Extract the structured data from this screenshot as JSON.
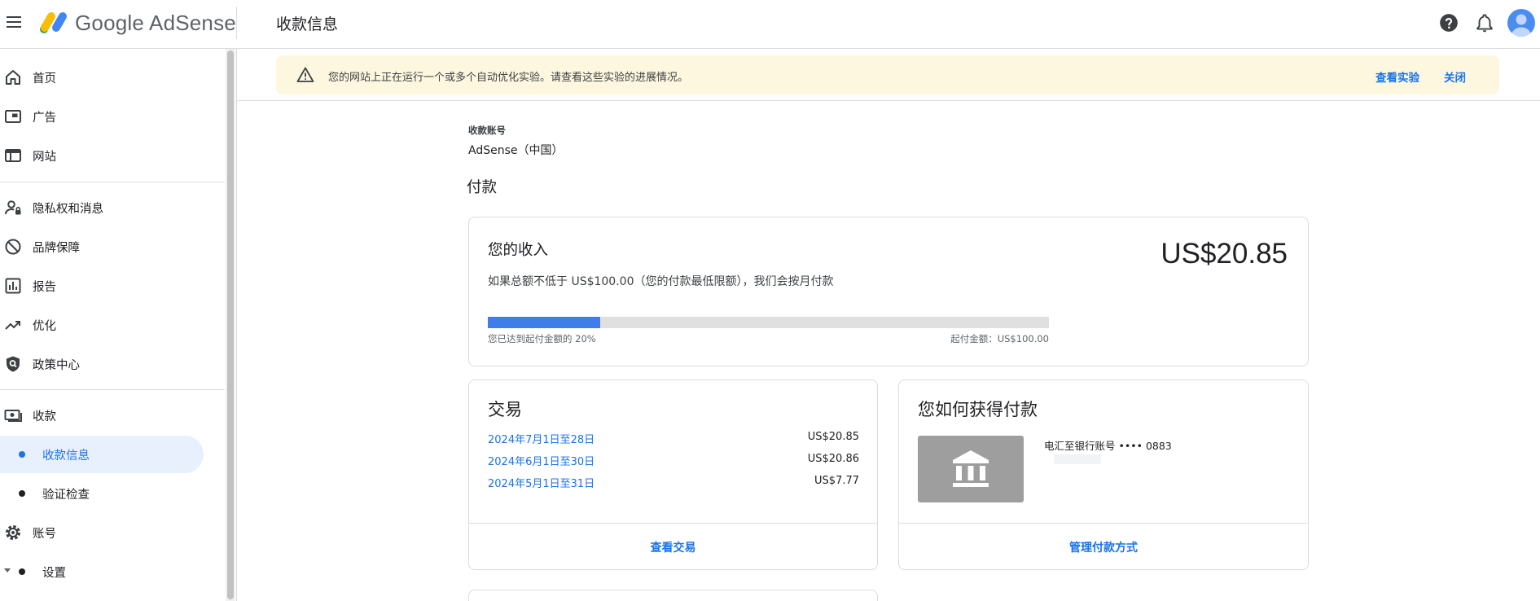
{
  "header": {
    "brand": "Google AdSense",
    "page_title": "收款信息"
  },
  "sidebar": {
    "items": [
      {
        "label": "首页",
        "icon": "home-icon"
      },
      {
        "label": "广告",
        "icon": "ads-icon"
      },
      {
        "label": "网站",
        "icon": "sites-icon"
      },
      {
        "label": "隐私权和消息",
        "icon": "privacy-icon"
      },
      {
        "label": "品牌保障",
        "icon": "block-icon"
      },
      {
        "label": "报告",
        "icon": "reports-icon"
      },
      {
        "label": "优化",
        "icon": "trending-icon"
      },
      {
        "label": "政策中心",
        "icon": "policy-shield-icon"
      },
      {
        "label": "收款",
        "icon": "payments-icon"
      },
      {
        "label": "收款信息",
        "active": true
      },
      {
        "label": "验证检查"
      },
      {
        "label": "账号",
        "icon": "gear-icon"
      },
      {
        "label": "设置"
      }
    ]
  },
  "banner": {
    "text": "您的网站上正在运行一个或多个自动优化实验。请查看这些实验的进展情况。",
    "view_label": "查看实验",
    "close_label": "关闭"
  },
  "account": {
    "label": "收款账号",
    "value": "AdSense（中国）"
  },
  "section_title": "付款",
  "earnings": {
    "title": "您的收入",
    "amount": "US$20.85",
    "description": "如果总额不低于 US$100.00（您的付款最低限额），我们会按月付款",
    "progress_percent": 20,
    "progress_left": "您已达到起付金额的 20%",
    "progress_right": "起付金额：US$100.00"
  },
  "transactions": {
    "title": "交易",
    "rows": [
      {
        "date": "2024年7月1日至28日",
        "amount": "US$20.85"
      },
      {
        "date": "2024年6月1日至30日",
        "amount": "US$20.86"
      },
      {
        "date": "2024年5月1日至31日",
        "amount": "US$7.77"
      }
    ],
    "action": "查看交易"
  },
  "payment_method": {
    "title": "您如何获得付款",
    "bank_text": "电汇至银行账号 •••• 0883",
    "action": "管理付款方式"
  },
  "colors": {
    "accent": "#1a73e8",
    "banner_bg": "#fef7e0",
    "progress_fill": "#3f7ee8",
    "active_nav_bg": "#e8f0fe"
  }
}
